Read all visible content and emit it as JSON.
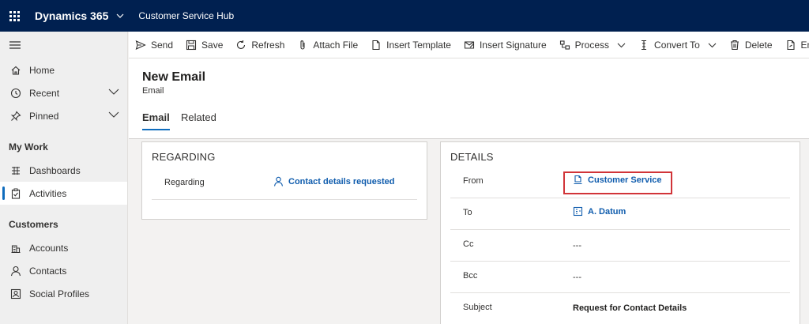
{
  "topbar": {
    "app_name": "Dynamics 365",
    "hub_name": "Customer Service Hub",
    "bg_color": "#002050"
  },
  "sidebar": {
    "items_top": [
      {
        "label": "Home",
        "icon": "home-icon"
      },
      {
        "label": "Recent",
        "icon": "clock-icon",
        "expandable": true
      },
      {
        "label": "Pinned",
        "icon": "pin-icon",
        "expandable": true
      }
    ],
    "group_my_work": "My Work",
    "items_my_work": [
      {
        "label": "Dashboards",
        "icon": "dashboard-icon"
      },
      {
        "label": "Activities",
        "icon": "clipboard-icon",
        "active": true
      }
    ],
    "group_customers": "Customers",
    "items_customers": [
      {
        "label": "Accounts",
        "icon": "building-icon"
      },
      {
        "label": "Contacts",
        "icon": "person-icon"
      },
      {
        "label": "Social Profiles",
        "icon": "social-icon"
      }
    ]
  },
  "commandbar": {
    "send": "Send",
    "save": "Save",
    "refresh": "Refresh",
    "attach_file": "Attach File",
    "insert_template": "Insert Template",
    "insert_signature": "Insert Signature",
    "process": "Process",
    "convert_to": "Convert To",
    "delete": "Delete",
    "email_link": "Email a Link"
  },
  "header": {
    "title": "New Email",
    "entity": "Email",
    "tabs": [
      "Email",
      "Related"
    ],
    "active_tab": "Email"
  },
  "regarding": {
    "title": "REGARDING",
    "label": "Regarding",
    "value": "Contact details requested"
  },
  "details": {
    "title": "DETAILS",
    "from_label": "From",
    "from_value": "Customer Service",
    "to_label": "To",
    "to_value": "A. Datum",
    "cc_label": "Cc",
    "cc_value": "---",
    "bcc_label": "Bcc",
    "bcc_value": "---",
    "subject_label": "Subject",
    "subject_value": "Request for Contact Details"
  },
  "colors": {
    "accent": "#0f6cbd",
    "link": "#0f5cad",
    "highlight": "#d13438"
  }
}
